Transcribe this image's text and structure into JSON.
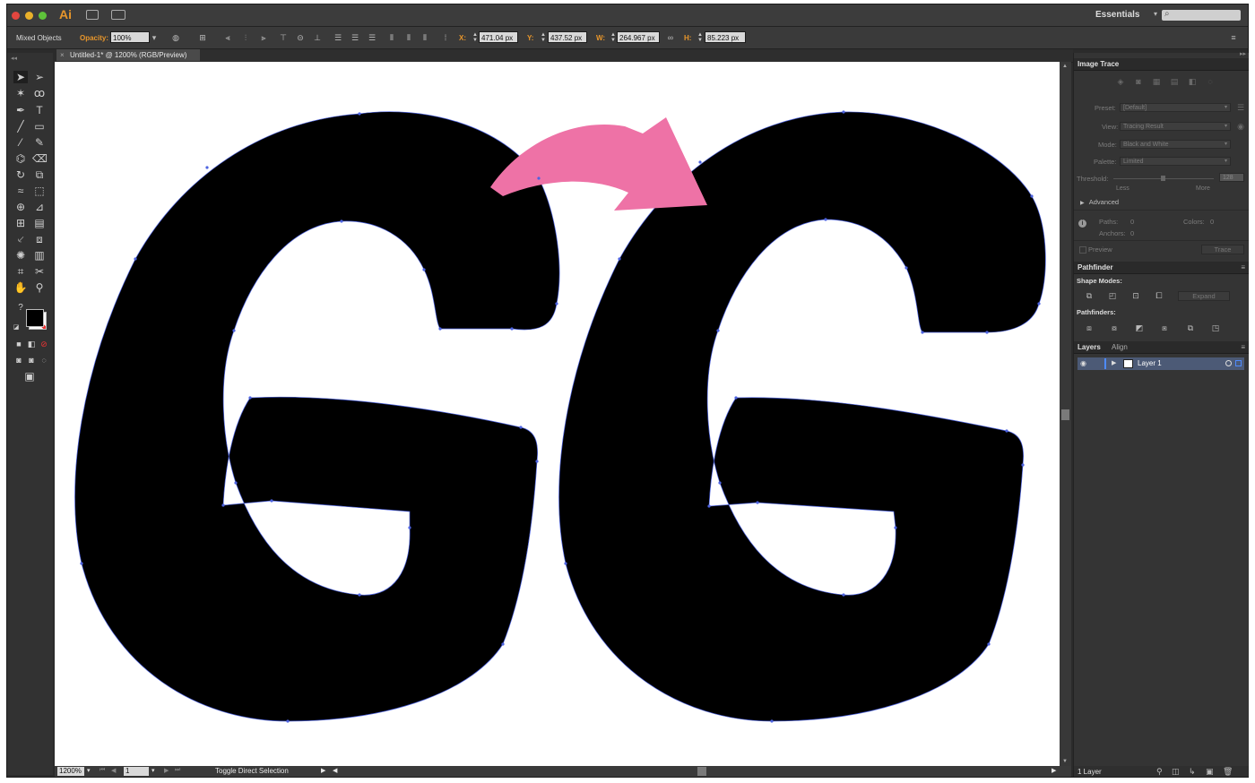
{
  "app": {
    "logo": "Ai",
    "workspace": "Essentials"
  },
  "controlbar": {
    "selection": "Mixed Objects",
    "opacity_label": "Opacity:",
    "opacity_value": "100%",
    "x_label": "X:",
    "x_value": "471.04 px",
    "y_label": "Y:",
    "y_value": "437.52 px",
    "w_label": "W:",
    "w_value": "264.967 px",
    "h_label": "H:",
    "h_value": "85.223 px"
  },
  "document": {
    "tab_title": "Untitled-1* @ 1200% (RGB/Preview)"
  },
  "statusbar": {
    "zoom": "1200%",
    "page": "1",
    "message": "Toggle Direct Selection"
  },
  "image_trace": {
    "title": "Image Trace",
    "preset_label": "Preset:",
    "preset_value": "[Default]",
    "view_label": "View:",
    "view_value": "Tracing Result",
    "mode_label": "Mode:",
    "mode_value": "Black and White",
    "palette_label": "Palette:",
    "palette_value": "Limited",
    "threshold_label": "Threshold:",
    "threshold_value": "128",
    "less": "Less",
    "more": "More",
    "advanced": "Advanced",
    "paths_label": "Paths:",
    "paths_value": "0",
    "colors_label": "Colors:",
    "colors_value": "0",
    "anchors_label": "Anchors:",
    "anchors_value": "0",
    "preview": "Preview",
    "trace_button": "Trace"
  },
  "pathfinder": {
    "title": "Pathfinder",
    "shape_modes": "Shape Modes:",
    "expand_button": "Expand",
    "pathfinders": "Pathfinders:"
  },
  "layers": {
    "tab_layers": "Layers",
    "tab_align": "Align",
    "layer_name": "Layer 1",
    "count": "1 Layer"
  },
  "colors": {
    "arrow": "#ee72a6",
    "path_outline": "#4d63e0",
    "glyph_fill": "#000000",
    "accent": "#e8962b"
  }
}
